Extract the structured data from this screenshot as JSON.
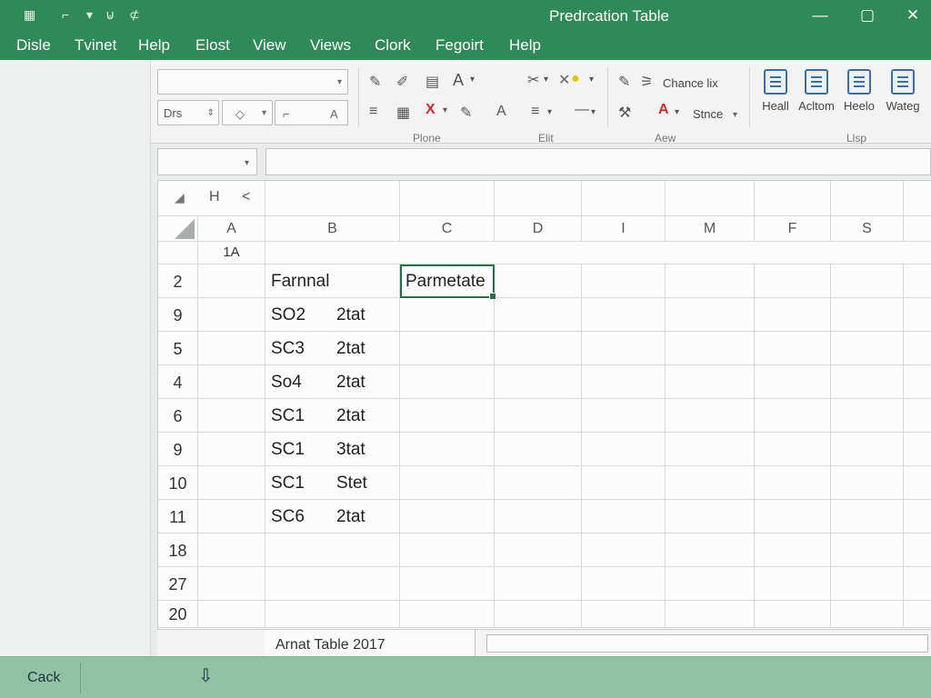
{
  "window": {
    "title": "Predrcation Table",
    "quick_access": [
      "▦",
      "⌐",
      "▾",
      "⊍",
      "⊄"
    ],
    "controls": {
      "minimize": "—",
      "maximize": "▢",
      "close": "✕"
    }
  },
  "menu": [
    "Disle",
    "Tvinet",
    "Help",
    "Elost",
    "View",
    "Views",
    "Clork",
    "Fegoirt",
    "Help"
  ],
  "ribbon": {
    "font_size_value": "Drs",
    "tools_top": [
      "✎",
      "✐",
      "▤",
      "A",
      "▾",
      "✂",
      "▾",
      "✕",
      "▾",
      "●",
      "▾",
      "✎",
      "⚞"
    ],
    "change_label": "Chance lix",
    "style_label": "Stnce",
    "tools_bottom": [
      "≡",
      "▦",
      "X",
      "▾",
      "✎",
      "A",
      "≡",
      "▾",
      "—",
      "▾",
      "⚒",
      "A",
      "▾"
    ],
    "groups": [
      "Plone",
      "Elit",
      "Aew",
      "Llsp"
    ],
    "big_buttons": [
      {
        "label": "Heall",
        "icon": "chart-doc-icon"
      },
      {
        "label": "Acltom",
        "icon": "edit-doc-icon"
      },
      {
        "label": "Heelo",
        "icon": "help-doc-icon"
      },
      {
        "label": "Wateg",
        "icon": "search-doc-icon"
      }
    ],
    "second_row_small": [
      "◇",
      "⌐",
      "A"
    ]
  },
  "grid": {
    "top_strip": [
      "H",
      "<"
    ],
    "columns": [
      "A",
      "B",
      "C",
      "D",
      "I",
      "M",
      "F",
      "S"
    ],
    "header_row_label": "1A",
    "rows": [
      {
        "num": "2",
        "b1": "Farnnal",
        "b2": "",
        "c": "Parmetate"
      },
      {
        "num": "9",
        "b1": "SO2",
        "b2": "2tat",
        "c": ""
      },
      {
        "num": "5",
        "b1": "SC3",
        "b2": "2tat",
        "c": ""
      },
      {
        "num": "4",
        "b1": "So4",
        "b2": "2tat",
        "c": ""
      },
      {
        "num": "6",
        "b1": "SC1",
        "b2": "2tat",
        "c": ""
      },
      {
        "num": "9",
        "b1": "SC1",
        "b2": "3tat",
        "c": ""
      },
      {
        "num": "10",
        "b1": "SC1",
        "b2": "Stet",
        "c": ""
      },
      {
        "num": "11",
        "b1": "SC6",
        "b2": "2tat",
        "c": ""
      },
      {
        "num": "18",
        "b1": "",
        "b2": "",
        "c": ""
      },
      {
        "num": "27",
        "b1": "",
        "b2": "",
        "c": ""
      },
      {
        "num": "20",
        "b1": "",
        "b2": "",
        "c": ""
      }
    ]
  },
  "sheet_tab": "Arnat Table 2017",
  "status": {
    "text": "Cack",
    "icon": "download-arrow-icon"
  },
  "colors": {
    "accent": "#2e8b57",
    "status_bar": "#8fc3a4",
    "selection": "#217346"
  }
}
